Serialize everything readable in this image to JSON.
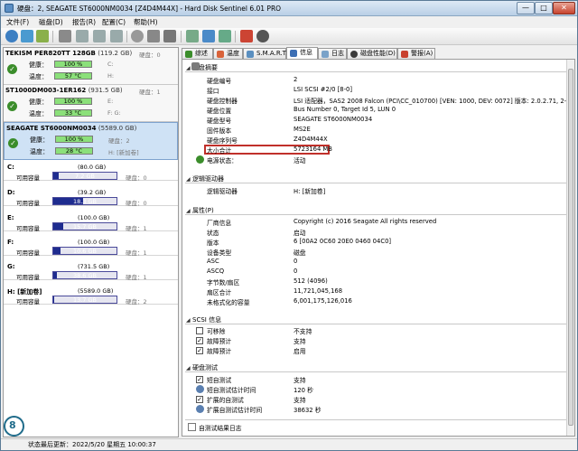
{
  "window": {
    "title": "硬盘：2, SEAGATE ST6000NM0034 [Z4D4M44X] - Hard Disk Sentinel 6.01 PRO",
    "buttons": {
      "minimize": "—",
      "maximize": "□",
      "close": "✕"
    }
  },
  "menu": [
    "文件(F)",
    "磁盘(D)",
    "报告(R)",
    "配置(C)",
    "帮助(H)"
  ],
  "disks": [
    {
      "name": "TEKISM PER820TT 128GB",
      "size": "(119.2 GB)",
      "side_top": "硬盘：0",
      "health_label": "健康：",
      "health_value": "100 %",
      "health_fraction": 1.0,
      "health_side": "C:",
      "temp_label": "温度：",
      "temp_value": "57 °C",
      "temp_side": "H:"
    },
    {
      "name": "ST1000DM003-1ER162",
      "size": "(931.5 GB)",
      "side_top": "硬盘：1",
      "health_label": "健康：",
      "health_value": "100 %",
      "health_fraction": 1.0,
      "health_side": "E:",
      "temp_label": "温度：",
      "temp_value": "33 °C",
      "temp_side": "F: G:"
    },
    {
      "name": "SEAGATE ST6000NM0034",
      "size": "(5589.0 GB)",
      "side_top": "",
      "health_label": "健康：",
      "health_value": "100 %",
      "health_fraction": 1.0,
      "health_side": "硬盘：2",
      "temp_label": "温度：",
      "temp_value": "28 °C",
      "temp_side": "H: [新加卷]"
    }
  ],
  "volumes": [
    {
      "letter": "C:",
      "size": "(80.0 GB)",
      "free_label": "可用容量",
      "free": "7.2 GB",
      "fraction": 0.09,
      "side": "硬盘：0"
    },
    {
      "letter": "D:",
      "size": "(39.2 GB)",
      "free_label": "可用容量",
      "free": "18.3 GB",
      "fraction": 0.47,
      "side": "硬盘：0"
    },
    {
      "letter": "E:",
      "size": "(100.0 GB)",
      "free_label": "可用容量",
      "free": "15.7 GB",
      "fraction": 0.16,
      "side": "硬盘：1"
    },
    {
      "letter": "F:",
      "size": "(100.0 GB)",
      "free_label": "可用容量",
      "free": "10.6 GB",
      "fraction": 0.11,
      "side": "硬盘：1"
    },
    {
      "letter": "G:",
      "size": "(731.5 GB)",
      "free_label": "可用容量",
      "free": "38.6 GB",
      "fraction": 0.05,
      "side": "硬盘：1"
    },
    {
      "letter": "H: [新加卷]",
      "size": "(5589.0 GB)",
      "free_label": "可用容量",
      "free": "13.7 GB",
      "fraction": 0.002,
      "side": "硬盘：2"
    }
  ],
  "tabs": [
    "综述",
    "温度",
    "S.M.A.R.T.",
    "信息",
    "日志",
    "磁盘性能(D)",
    "警报(A)"
  ],
  "summary_section": "硬盘摘要",
  "summary_rows": [
    {
      "k": "硬盘编号",
      "v": "2"
    },
    {
      "k": "接口",
      "v": "LSI  SCSI #2/0 [8-0]"
    },
    {
      "k": "硬盘控制器",
      "v": "LSI 适配器，SAS2 2008 Falcon (PCI\\CC_010700) [VEN: 1000, DEV: 0072] 版本: 2.0.2.71, 2-20-2..."
    },
    {
      "k": "硬盘位置",
      "v": "Bus Number 0, Target Id 5, LUN 0"
    },
    {
      "k": "硬盘型号",
      "v": "SEAGATE ST6000NM0034"
    },
    {
      "k": "固件版本",
      "v": "MS2E"
    },
    {
      "k": "硬盘序列号",
      "v": "Z4D4M44X"
    },
    {
      "k": "大小合计",
      "v": "5723164 MB"
    },
    {
      "k": "电源状态：",
      "v": "活动"
    }
  ],
  "logical_section": "逻辑驱动器",
  "logical_rows": [
    {
      "k": "逻辑驱动器",
      "v": "H: [新加卷]"
    }
  ],
  "props_section": "属性(P)",
  "props_rows": [
    {
      "k": "厂商信息",
      "v": "Copyright (c) 2016 Seagate All rights reserved"
    },
    {
      "k": "状态",
      "v": "启动"
    },
    {
      "k": "版本",
      "v": "6 [00A2 0C60 20E0 0460 04C0]"
    },
    {
      "k": "设备类型",
      "v": "磁盘"
    },
    {
      "k": "ASC",
      "v": "0"
    },
    {
      "k": "ASCQ",
      "v": "0"
    },
    {
      "k": "字节数/扇区",
      "v": "512 (4096)"
    },
    {
      "k": "扇区合计",
      "v": "11,721,045,168"
    },
    {
      "k": "未格式化的容量",
      "v": "6,001,175,126,016"
    }
  ],
  "scsi_section": "SCSI 信息",
  "scsi_rows": [
    {
      "k": "可移除",
      "v": "不支持",
      "checked": false
    },
    {
      "k": "故障预计",
      "v": "支持",
      "checked": true
    },
    {
      "k": "故障预计",
      "v": "启用",
      "checked": true
    }
  ],
  "test_section": "硬盘测试",
  "test_rows": [
    {
      "k": "短自测试",
      "v": "支持"
    },
    {
      "k": "短自测试估计时间",
      "v": "120 秒"
    },
    {
      "k": "扩展的自测试",
      "v": "支持"
    },
    {
      "k": "扩展自测试估计时间",
      "v": "38632 秒"
    }
  ],
  "self_test_log": "自测试结果日志",
  "status_text": "状态最后更新：2022/5/20 星期五 10:00:37",
  "colors": {
    "health_bar": "#8be07a",
    "temp_bar": "#8be07a",
    "volume_bar": "#1e2c8f",
    "highlight_box": "#c0302a"
  }
}
